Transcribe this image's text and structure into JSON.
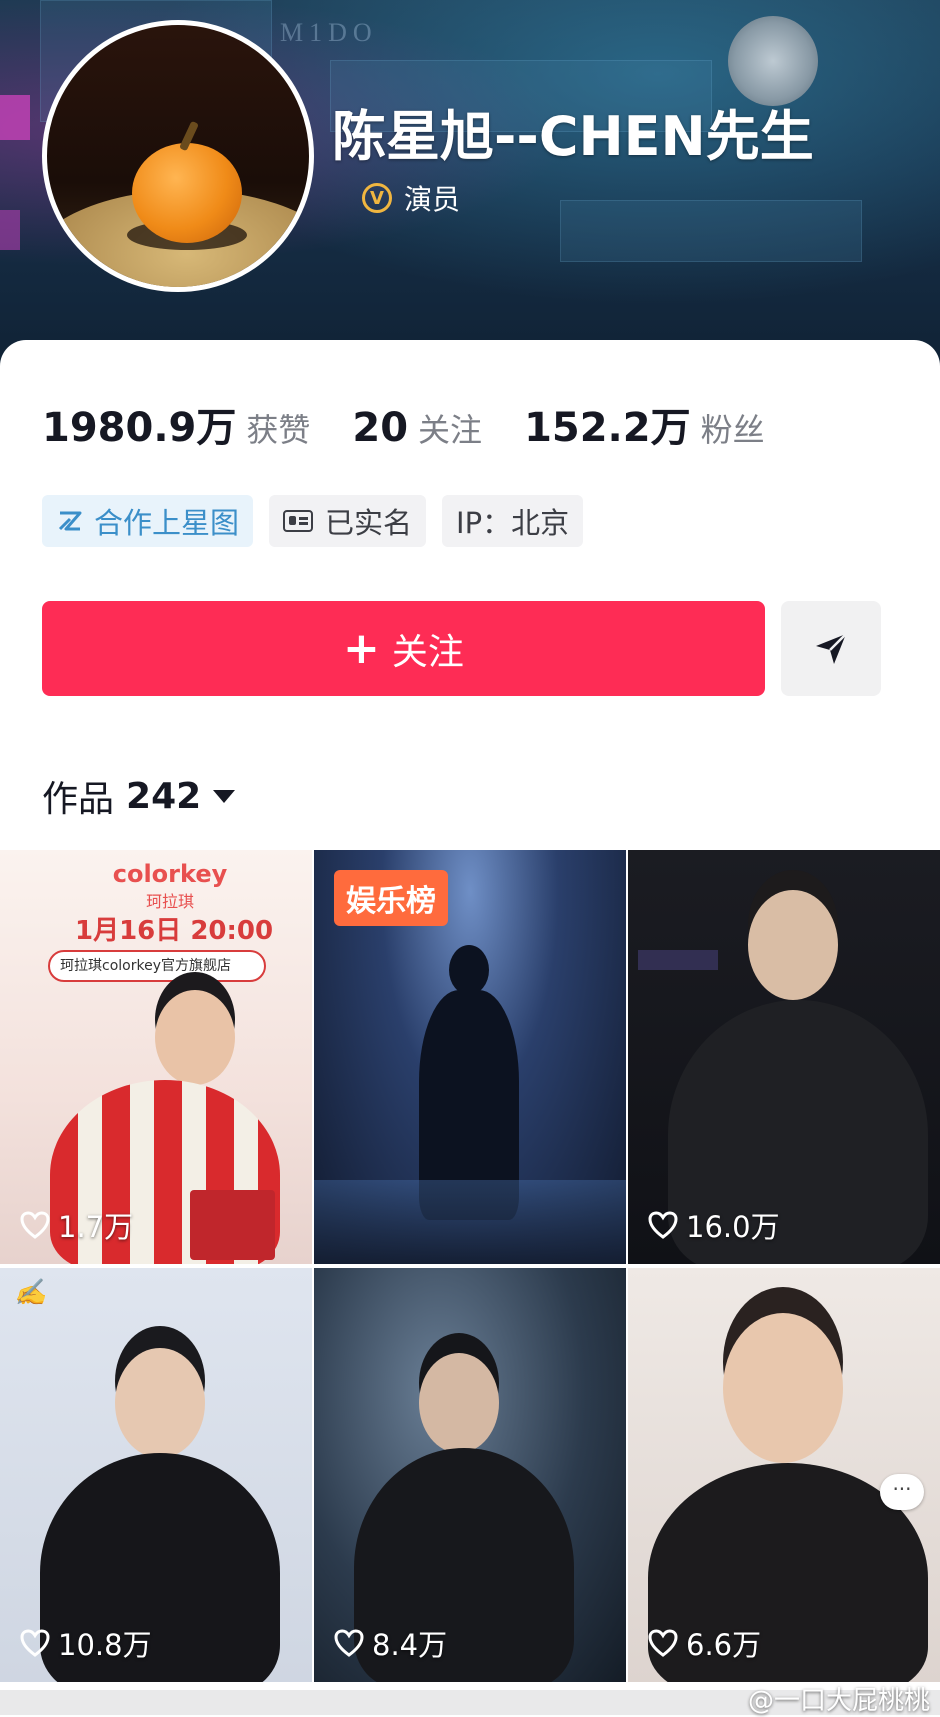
{
  "profile": {
    "name": "陈星旭--CHEN先生",
    "verified_label": "演员",
    "banner_text": "M1DO"
  },
  "stats": [
    {
      "value": "1980.9万",
      "label": "获赞"
    },
    {
      "value": "20",
      "label": "关注"
    },
    {
      "value": "152.2万",
      "label": "粉丝"
    }
  ],
  "tags": {
    "cooperate": "合作上星图",
    "realname": "已实名",
    "ip": "IP：北京"
  },
  "actions": {
    "follow_label": "关注",
    "follow_color": "#fe2c55"
  },
  "works": {
    "label": "作品",
    "count": "242"
  },
  "grid": {
    "promo": {
      "brand": "colorkey",
      "brand_cn": "珂拉琪",
      "date": "1月16日 20:00",
      "shop": "珂拉琪colorkey官方旗舰店"
    },
    "badge": "娱乐榜",
    "items": [
      {
        "likes": "1.7万"
      },
      {
        "likes": ""
      },
      {
        "likes": "16.0万"
      },
      {
        "likes": "10.8万"
      },
      {
        "likes": "8.4万"
      },
      {
        "likes": "6.6万"
      }
    ],
    "more_icon": "···"
  },
  "watermark": "@一口大屁桃桃"
}
